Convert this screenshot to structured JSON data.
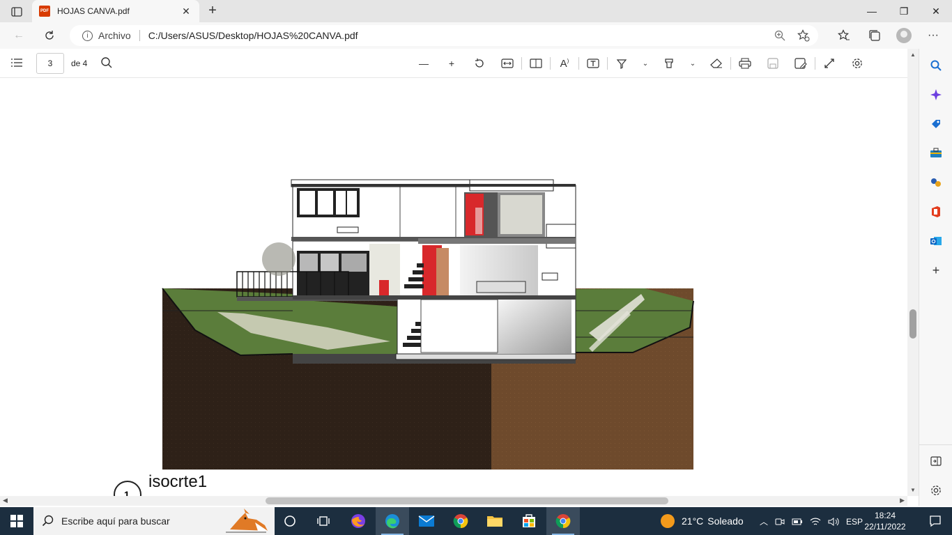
{
  "browser": {
    "tab_title": "HOJAS CANVA.pdf",
    "archivo_label": "Archivo",
    "url": "C:/Users/ASUS/Desktop/HOJAS%20CANVA.pdf"
  },
  "pdf_toolbar": {
    "current_page": "3",
    "page_total_label": "de 4"
  },
  "document": {
    "caption_number": "1",
    "caption_title": "isocrte1"
  },
  "taskbar": {
    "search_placeholder": "Escribe aquí para buscar",
    "weather_temp": "21°C",
    "weather_desc": "Soleado",
    "language": "ESP",
    "time": "18:24",
    "date": "22/11/2022"
  },
  "colors": {
    "soil_left": "#2e2118",
    "soil_right": "#6e4a2c",
    "grass": "#5b7d3b",
    "accent_red": "#d8282b",
    "taskbar_bg": "#1c2e3f"
  }
}
